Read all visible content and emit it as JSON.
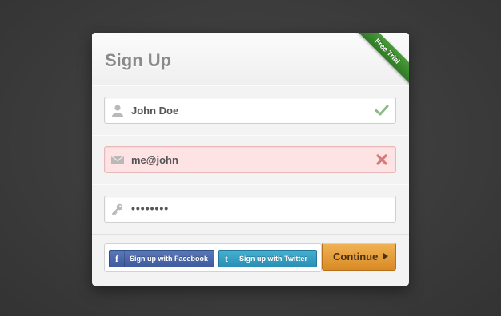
{
  "form": {
    "title": "Sign Up",
    "ribbon": "Free Trial",
    "name_field": {
      "value": "John Doe",
      "icon": "user-icon",
      "status": "valid",
      "status_icon": "checkmark-icon"
    },
    "email_field": {
      "value": "me@john",
      "icon": "mail-icon",
      "status": "invalid",
      "status_icon": "cross-icon"
    },
    "password_field": {
      "value": "••••••••",
      "icon": "key-icon"
    },
    "facebook_button": {
      "label": "Sign up with Facebook",
      "icon_text": "f"
    },
    "twitter_button": {
      "label": "Sign up with Twitter",
      "icon_text": "t"
    },
    "continue_button": {
      "label": "Continue"
    }
  },
  "colors": {
    "ribbon": "#3a8a2e",
    "valid": "#8db88a",
    "invalid": "#d77a7a",
    "facebook": "#3e5c9e",
    "twitter": "#2a8fb4",
    "continue": "#e39a35"
  }
}
